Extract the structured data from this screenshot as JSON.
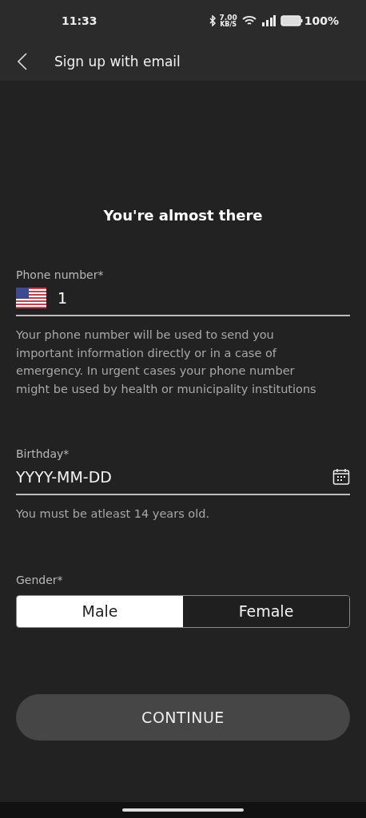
{
  "status_bar": {
    "time": "11:33",
    "speed": "7.00",
    "speed_unit": "KB/S",
    "battery": "100%"
  },
  "header": {
    "title": "Sign up with email"
  },
  "heading": "You're almost there",
  "phone": {
    "label": "Phone number*",
    "value": "1",
    "helper": "Your phone number will be used to send you important information directly or in a case of emergency. In urgent cases your phone number might be used by health or municipality institutions"
  },
  "birthday": {
    "label": "Birthday*",
    "placeholder": "YYYY-MM-DD",
    "helper": "You must be atleast 14 years old."
  },
  "gender": {
    "label": "Gender*",
    "options": [
      {
        "label": "Male",
        "selected": true
      },
      {
        "label": "Female",
        "selected": false
      }
    ]
  },
  "continue_button": "CONTINUE"
}
